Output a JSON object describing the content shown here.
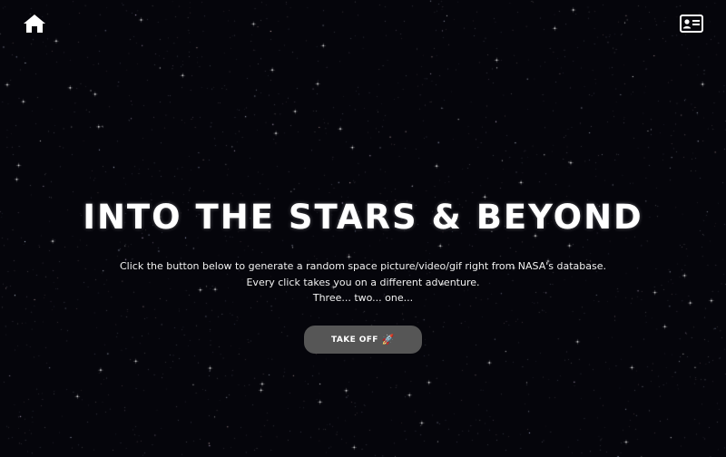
{
  "nav": {
    "home_icon": "home-icon",
    "profile_icon": "id-card-icon"
  },
  "hero": {
    "title": "INTO THE STARS & BEYOND",
    "description_lines": [
      "Click the button below to generate a random space picture/video/gif right from NASA's database.",
      "Every click takes you on a different adventure.",
      "Three... two... one..."
    ],
    "button_label": "TAKE OFF",
    "button_icon": "🚀"
  },
  "colors": {
    "background": "#05050b",
    "button_bg": "#565656",
    "text": "#ffffff"
  }
}
